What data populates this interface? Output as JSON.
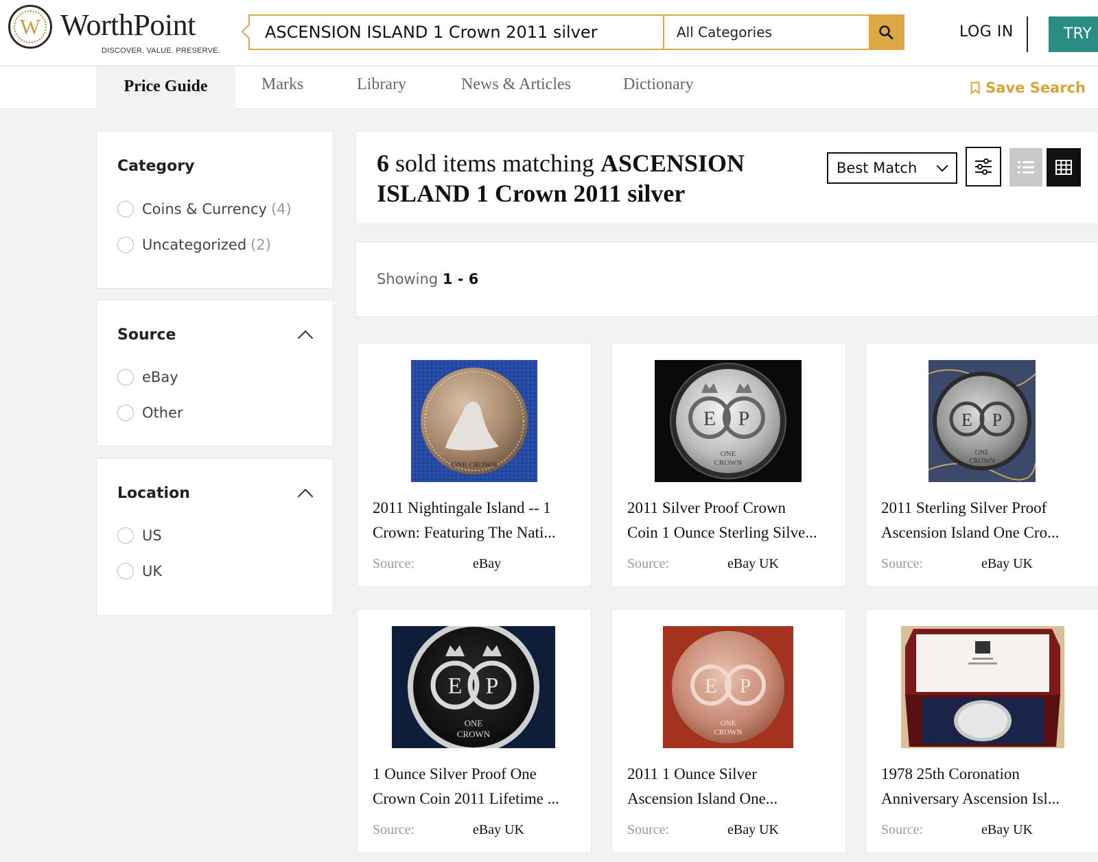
{
  "brand": {
    "name": "WorthPoint",
    "tagline": "DISCOVER. VALUE. PRESERVE.",
    "accent": "#dba843",
    "teal": "#2b8c84"
  },
  "header": {
    "search_value": "ASCENSION ISLAND 1 Crown 2011 silver",
    "category": "All Categories",
    "login": "LOG IN",
    "try": "TRY"
  },
  "nav": {
    "items": [
      "Price Guide",
      "Marks",
      "Library",
      "News & Articles",
      "Dictionary"
    ],
    "save_search": "Save Search"
  },
  "sidebar": {
    "category": {
      "title": "Category",
      "options": [
        {
          "label": "Coins & Currency",
          "count": "(4)"
        },
        {
          "label": "Uncategorized",
          "count": "(2)"
        }
      ]
    },
    "source": {
      "title": "Source",
      "options": [
        "eBay",
        "Other"
      ]
    },
    "location": {
      "title": "Location",
      "options": [
        "US",
        "UK"
      ]
    }
  },
  "results": {
    "count": "6",
    "title_mid": " sold items matching ",
    "query_line1": "ASCENSION",
    "query_line2": "ISLAND 1 Crown 2011 silver",
    "sort": "Best Match",
    "showing_label": "Showing ",
    "showing_range": "1 - 6"
  },
  "cards": [
    {
      "line1": "2011 Nightingale Island -- 1",
      "line2": "Crown: Featuring The Nati...",
      "source_label": "Source:",
      "source": "eBay",
      "icon": "seal-coin-image"
    },
    {
      "line1": "2011 Silver Proof Crown",
      "line2": "Coin 1 Ounce Sterling Silve...",
      "source_label": "Source:",
      "source": "eBay UK",
      "icon": "ep-coin-image"
    },
    {
      "line1": "2011 Sterling Silver Proof",
      "line2": "Ascension Island One Cro...",
      "source_label": "Source:",
      "source": "eBay UK",
      "icon": "ep-coin-image"
    },
    {
      "line1": "1 Ounce Silver Proof One",
      "line2": "Crown Coin 2011 Lifetime ...",
      "source_label": "Source:",
      "source": "eBay UK",
      "icon": "ep-coin-image"
    },
    {
      "line1": "2011 1 Ounce Silver",
      "line2": "Ascension Island One...",
      "source_label": "Source:",
      "source": "eBay UK",
      "icon": "ep-coin-image"
    },
    {
      "line1": "1978 25th Coronation",
      "line2": "Anniversary Ascension Isl...",
      "source_label": "Source:",
      "source": "eBay UK",
      "icon": "coin-case-image"
    }
  ]
}
